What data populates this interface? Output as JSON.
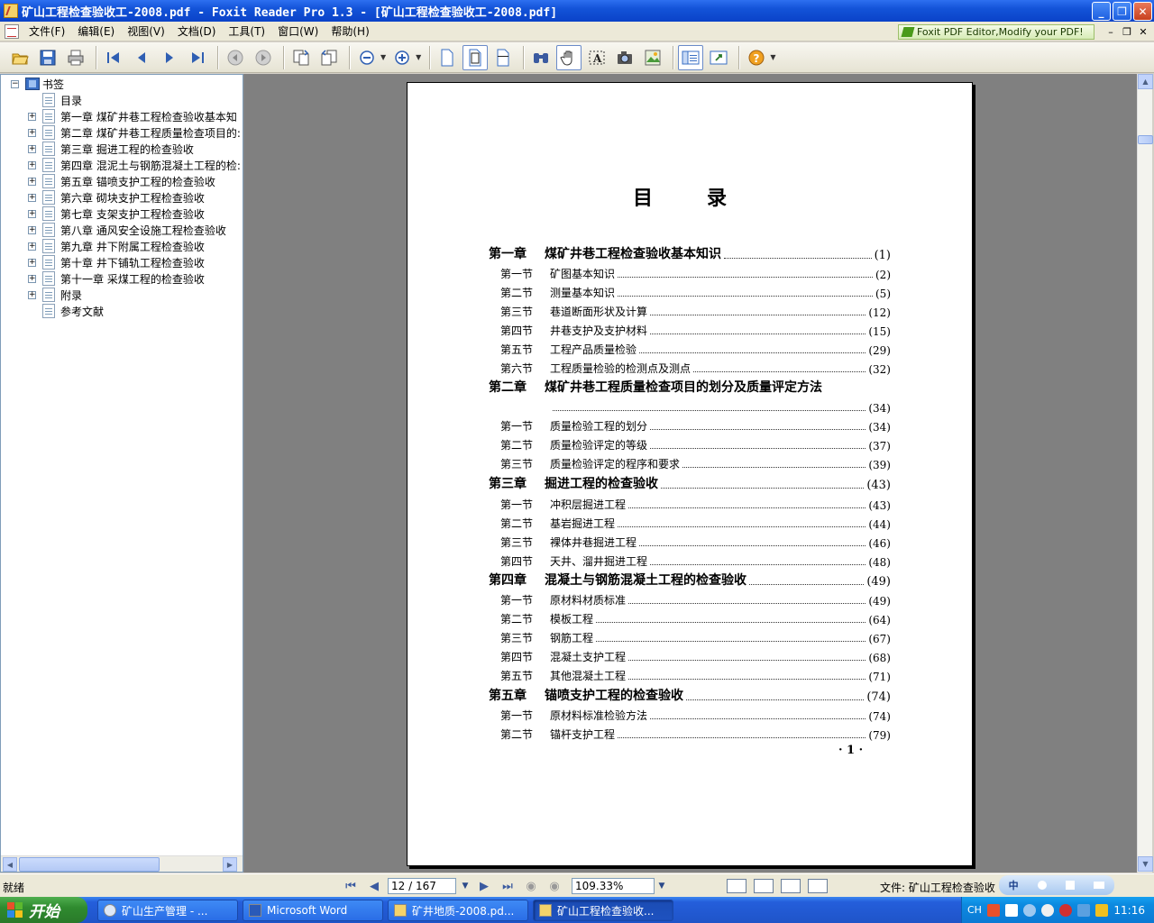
{
  "window": {
    "title": "矿山工程检查验收工-2008.pdf - Foxit Reader Pro 1.3 - [矿山工程检查验收工-2008.pdf]",
    "minimize": "_",
    "restore": "❐",
    "close": "✕"
  },
  "menu": {
    "items": [
      "文件(F)",
      "编辑(E)",
      "视图(V)",
      "文档(D)",
      "工具(T)",
      "窗口(W)",
      "帮助(H)"
    ],
    "promo": "Foxit PDF Editor,Modify your PDF!",
    "mdi_min": "–",
    "mdi_restore": "❐",
    "mdi_close": "✕"
  },
  "toolbar": {
    "icons": [
      "open-icon",
      "save-icon",
      "print-icon",
      "first-page-icon",
      "prev-page-icon",
      "next-page-icon",
      "last-page-icon",
      "back-icon",
      "forward-icon",
      "rotate-left-icon",
      "rotate-right-icon",
      "zoom-out-icon",
      "zoom-in-icon",
      "actual-size-icon",
      "fit-page-icon",
      "fit-width-icon",
      "find-icon",
      "hand-tool-icon",
      "select-text-icon",
      "snapshot-icon",
      "select-graphics-icon",
      "bookmark-panel-icon",
      "full-screen-icon",
      "help-icon"
    ]
  },
  "bookmarks": {
    "root": "书签",
    "items": [
      {
        "label": "目录",
        "expandable": false
      },
      {
        "label": "第一章 煤矿井巷工程检查验收基本知",
        "expandable": true
      },
      {
        "label": "第二章 煤矿井巷工程质量检查项目的:",
        "expandable": true
      },
      {
        "label": "第三章 掘进工程的检查验收",
        "expandable": true
      },
      {
        "label": "第四章 混泥土与钢筋混凝土工程的检:",
        "expandable": true
      },
      {
        "label": "第五章 锚喷支护工程的检查验收",
        "expandable": true
      },
      {
        "label": "第六章 砌块支护工程检查验收",
        "expandable": true
      },
      {
        "label": "第七章 支架支护工程检查验收",
        "expandable": true
      },
      {
        "label": "第八章 通风安全设施工程检查验收",
        "expandable": true
      },
      {
        "label": "第九章 井下附属工程检查验收",
        "expandable": true
      },
      {
        "label": "第十章 井下铺轨工程检查验收",
        "expandable": true
      },
      {
        "label": "第十一章 采煤工程的检查验收",
        "expandable": true
      },
      {
        "label": "附录",
        "expandable": true
      },
      {
        "label": "参考文献",
        "expandable": false
      }
    ]
  },
  "page": {
    "title": "目录",
    "toc": [
      {
        "level": "chapter",
        "sec": "第一章",
        "text": "煤矿井巷工程检查验收基本知识",
        "page": "(1)"
      },
      {
        "level": "section",
        "sec": "第一节",
        "text": "矿图基本知识",
        "page": "(2)"
      },
      {
        "level": "section",
        "sec": "第二节",
        "text": "测量基本知识",
        "page": "(5)"
      },
      {
        "level": "section",
        "sec": "第三节",
        "text": "巷道断面形状及计算",
        "page": "(12)"
      },
      {
        "level": "section",
        "sec": "第四节",
        "text": "井巷支护及支护材料",
        "page": "(15)"
      },
      {
        "level": "section",
        "sec": "第五节",
        "text": "工程产品质量检验",
        "page": "(29)"
      },
      {
        "level": "section",
        "sec": "第六节",
        "text": "工程质量检验的检测点及测点",
        "page": "(32)"
      },
      {
        "level": "chapter",
        "sec": "第二章",
        "text": "煤矿井巷工程质量检查项目的划分及质量评定方法",
        "page": ""
      },
      {
        "level": "cont",
        "sec": "",
        "text": "",
        "page": "(34)"
      },
      {
        "level": "section",
        "sec": "第一节",
        "text": "质量检验工程的划分",
        "page": "(34)"
      },
      {
        "level": "section",
        "sec": "第二节",
        "text": "质量检验评定的等级",
        "page": "(37)"
      },
      {
        "level": "section",
        "sec": "第三节",
        "text": "质量检验评定的程序和要求",
        "page": "(39)"
      },
      {
        "level": "chapter",
        "sec": "第三章",
        "text": "掘进工程的检查验收",
        "page": "(43)"
      },
      {
        "level": "section",
        "sec": "第一节",
        "text": "冲积层掘进工程",
        "page": "(43)"
      },
      {
        "level": "section",
        "sec": "第二节",
        "text": "基岩掘进工程",
        "page": "(44)"
      },
      {
        "level": "section",
        "sec": "第三节",
        "text": "裸体井巷掘进工程",
        "page": "(46)"
      },
      {
        "level": "section",
        "sec": "第四节",
        "text": "天井、溜井掘进工程",
        "page": "(48)"
      },
      {
        "level": "chapter",
        "sec": "第四章",
        "text": "混凝土与钢筋混凝土工程的检查验收",
        "page": "(49)"
      },
      {
        "level": "section",
        "sec": "第一节",
        "text": "原材料材质标准",
        "page": "(49)"
      },
      {
        "level": "section",
        "sec": "第二节",
        "text": "模板工程",
        "page": "(64)"
      },
      {
        "level": "section",
        "sec": "第三节",
        "text": "钢筋工程",
        "page": "(67)"
      },
      {
        "level": "section",
        "sec": "第四节",
        "text": "混凝土支护工程",
        "page": "(68)"
      },
      {
        "level": "section",
        "sec": "第五节",
        "text": "其他混凝土工程",
        "page": "(71)"
      },
      {
        "level": "chapter",
        "sec": "第五章",
        "text": "锚喷支护工程的检查验收",
        "page": "(74)"
      },
      {
        "level": "section",
        "sec": "第一节",
        "text": "原材料标准检验方法",
        "page": "(74)"
      },
      {
        "level": "section",
        "sec": "第二节",
        "text": "锚杆支护工程",
        "page": "(79)"
      }
    ],
    "footer_page_number": "· 1 ·"
  },
  "statusbar": {
    "status": "就绪",
    "page_indicator": "12 / 167",
    "zoom": "109.33%",
    "file_label": "文件: 矿山工程检查验收"
  },
  "ime": {
    "label": "中"
  },
  "taskbar": {
    "start": "开始",
    "tasks": [
      {
        "label": "矿山生产管理 - ...",
        "active": false
      },
      {
        "label": "Microsoft Word",
        "active": false
      },
      {
        "label": "矿井地质-2008.pd...",
        "active": false
      },
      {
        "label": "矿山工程检查验收...",
        "active": true
      }
    ],
    "tray_lang": "CH",
    "clock": "11:16"
  }
}
